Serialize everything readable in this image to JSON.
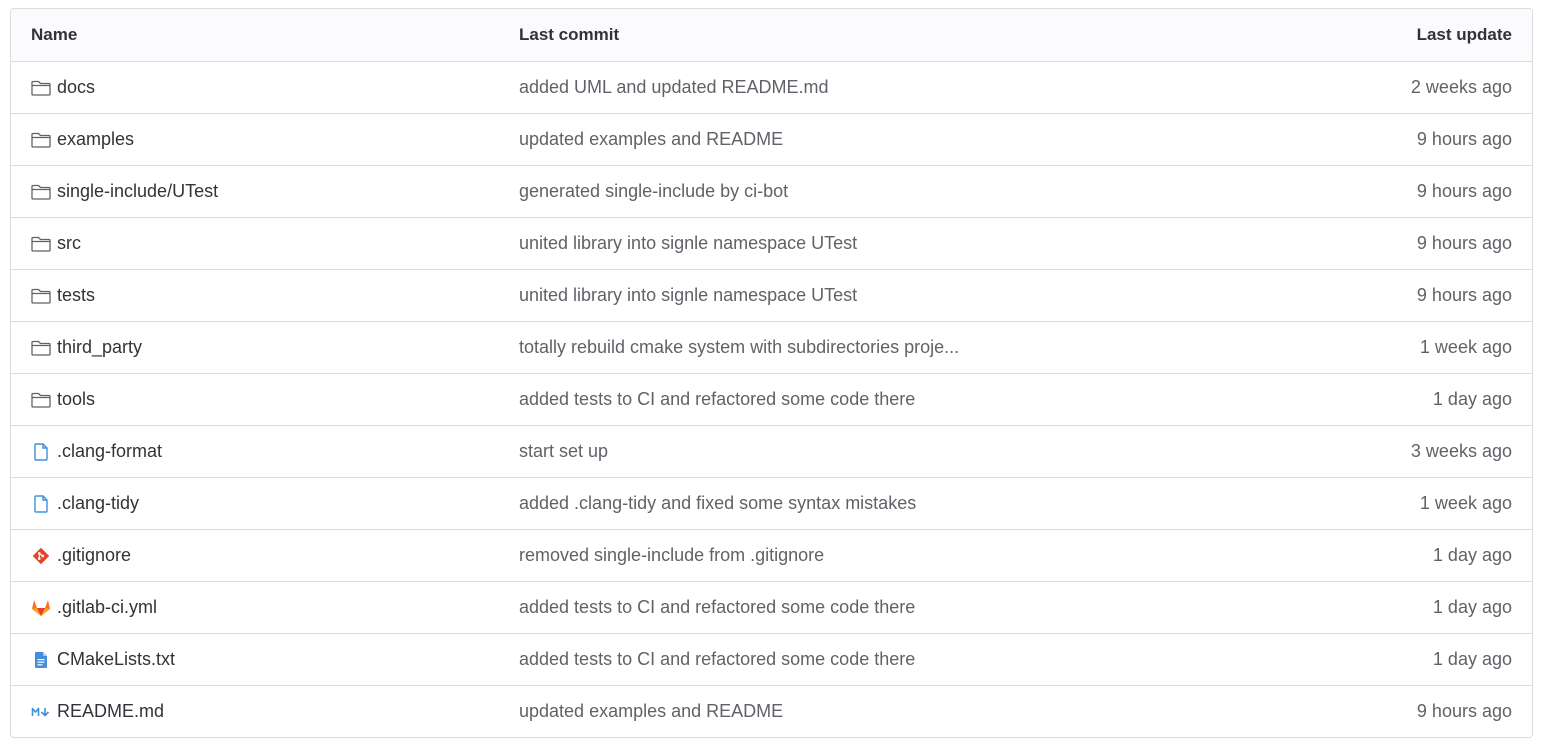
{
  "headers": {
    "name": "Name",
    "last_commit": "Last commit",
    "last_update": "Last update"
  },
  "rows": [
    {
      "icon": "folder-icon",
      "name": "docs",
      "commit": "added UML and updated README.md",
      "updated": "2 weeks ago"
    },
    {
      "icon": "folder-icon",
      "name": "examples",
      "commit": "updated examples and README",
      "updated": "9 hours ago"
    },
    {
      "icon": "folder-icon",
      "name": "single-include/UTest",
      "commit": "generated single-include by ci-bot",
      "updated": "9 hours ago"
    },
    {
      "icon": "folder-icon",
      "name": "src",
      "commit": "united library into signle namespace UTest",
      "updated": "9 hours ago"
    },
    {
      "icon": "folder-icon",
      "name": "tests",
      "commit": "united library into signle namespace UTest",
      "updated": "9 hours ago"
    },
    {
      "icon": "folder-icon",
      "name": "third_party",
      "commit": "totally rebuild cmake system with subdirectories proje...",
      "updated": "1 week ago"
    },
    {
      "icon": "folder-icon",
      "name": "tools",
      "commit": "added tests to CI and refactored some code there",
      "updated": "1 day ago"
    },
    {
      "icon": "file-icon",
      "name": ".clang-format",
      "commit": "start set up",
      "updated": "3 weeks ago"
    },
    {
      "icon": "file-icon",
      "name": ".clang-tidy",
      "commit": "added .clang-tidy and fixed some syntax mistakes",
      "updated": "1 week ago"
    },
    {
      "icon": "git-icon",
      "name": ".gitignore",
      "commit": "removed single-include from .gitignore",
      "updated": "1 day ago"
    },
    {
      "icon": "gitlab-icon",
      "name": ".gitlab-ci.yml",
      "commit": "added tests to CI and refactored some code there",
      "updated": "1 day ago"
    },
    {
      "icon": "text-file-icon",
      "name": "CMakeLists.txt",
      "commit": "added tests to CI and refactored some code there",
      "updated": "1 day ago"
    },
    {
      "icon": "markdown-icon",
      "name": "README.md",
      "commit": "updated examples and README",
      "updated": "9 hours ago"
    }
  ],
  "colors": {
    "border": "#dcdcde",
    "header_bg": "#fbfafd",
    "text": "#333238",
    "muted": "#626168",
    "file_blue": "#428fdc",
    "git_red": "#e24329",
    "gitlab_orange": "#fc6d26"
  }
}
